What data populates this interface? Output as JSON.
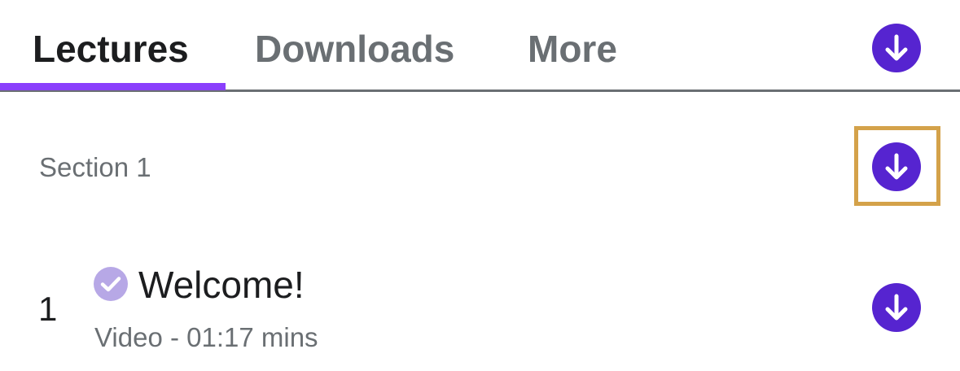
{
  "tabs": [
    {
      "label": "Lectures",
      "active": true
    },
    {
      "label": "Downloads",
      "active": false
    },
    {
      "label": "More",
      "active": false
    }
  ],
  "colors": {
    "accent": "#5624d0",
    "active_tab_underline": "#8a3ffc",
    "text_primary": "#1c1d1f",
    "text_secondary": "#6a6f73",
    "check_badge": "#b7a8e6",
    "highlight_box": "#d4a24a"
  },
  "header": {
    "download_all_icon": "download-icon"
  },
  "section": {
    "title": "Section 1",
    "download_icon": "download-icon"
  },
  "lecture": {
    "number": "1",
    "title": "Welcome!",
    "meta": "Video - 01:17 mins",
    "status_icon": "check-circle-icon",
    "download_icon": "download-icon"
  }
}
